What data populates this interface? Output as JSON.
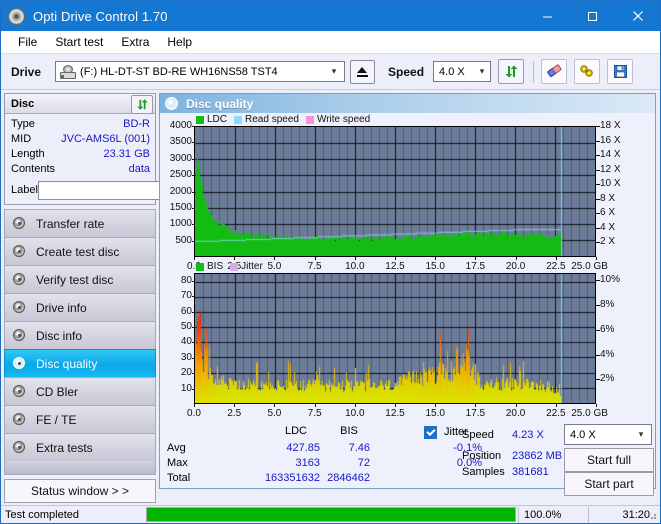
{
  "window": {
    "title": "Opti Drive Control 1.70",
    "icon": "disc-icon",
    "minimize": "minimize-icon",
    "maximize": "maximize-icon",
    "close": "close-icon"
  },
  "menu": {
    "items": [
      "File",
      "Start test",
      "Extra",
      "Help"
    ]
  },
  "toolbar": {
    "drive_label": "Drive",
    "drive_value": "(F:)  HL-DT-ST BD-RE  WH16NS58 TST4",
    "eject": "eject-icon",
    "speed_label": "Speed",
    "speed_value": "4.0 X",
    "refresh": "refresh-icon",
    "erase": "eraser-icon",
    "tools": "tools-icon",
    "save": "save-icon"
  },
  "disc": {
    "header": "Disc",
    "refresh": "refresh-icon",
    "rows": [
      {
        "key": "Type",
        "value": "BD-R"
      },
      {
        "key": "MID",
        "value": "JVC-AMS6L (001)"
      },
      {
        "key": "Length",
        "value": "23.31 GB"
      },
      {
        "key": "Contents",
        "value": "data"
      }
    ],
    "label_key": "Label",
    "label_value": "",
    "label_placeholder": ""
  },
  "sidebar": {
    "items": [
      {
        "label": "Transfer rate",
        "active": false
      },
      {
        "label": "Create test disc",
        "active": false
      },
      {
        "label": "Verify test disc",
        "active": false
      },
      {
        "label": "Drive info",
        "active": false
      },
      {
        "label": "Disc info",
        "active": false
      },
      {
        "label": "Disc quality",
        "active": true
      },
      {
        "label": "CD Bler",
        "active": false
      },
      {
        "label": "FE / TE",
        "active": false
      },
      {
        "label": "Extra tests",
        "active": false
      }
    ],
    "status_button": "Status window > >"
  },
  "panel": {
    "title": "Disc quality",
    "icon": "disc-quality-icon"
  },
  "stats": {
    "col_ldc": "LDC",
    "col_bis": "BIS",
    "jitter_label": "Jitter",
    "jitter_checked": true,
    "rows": [
      {
        "name": "Avg",
        "ldc": "427.85",
        "bis": "7.46",
        "jitter": "-0.1%"
      },
      {
        "name": "Max",
        "ldc": "3163",
        "bis": "72",
        "jitter": "0.0%"
      },
      {
        "name": "Total",
        "ldc": "163351632",
        "bis": "2846462",
        "jitter": ""
      }
    ],
    "speed_label": "Speed",
    "speed_value": "4.23 X",
    "speed_select": "4.0 X",
    "position_label": "Position",
    "position_value": "23862 MB",
    "samples_label": "Samples",
    "samples_value": "381681",
    "start_full": "Start full",
    "start_part": "Start part"
  },
  "statusbar": {
    "text": "Test completed",
    "percent_text": "100.0%",
    "percent": 100,
    "time": "31:20"
  },
  "colors": {
    "accent": "#1477d1",
    "ldc": "#13bc13",
    "read_speed": "#8fd8f7",
    "write_speed": "#ff8fe0",
    "bis_high": "#e00000",
    "bis_low": "#d8e000",
    "plot_bg": "#6d7d99",
    "value_text": "#1818c8",
    "progress": "#00b400"
  },
  "chart_data": [
    {
      "type": "area",
      "name": "ldc-chart",
      "title": "Disc quality",
      "legend": [
        {
          "label": "LDC",
          "color": "#13bc13"
        },
        {
          "label": "Read speed",
          "color": "#8fd8f7"
        },
        {
          "label": "Write speed",
          "color": "#ff8fe0"
        }
      ],
      "legend_position": "top-left",
      "grid": true,
      "xlabel": "GB",
      "xlim": [
        0,
        25.0
      ],
      "xticks": [
        0.0,
        2.5,
        5.0,
        7.5,
        10.0,
        12.5,
        15.0,
        17.5,
        20.0,
        22.5,
        25.0
      ],
      "xticklabels": [
        "0.0",
        "2.5",
        "5.0",
        "7.5",
        "10.0",
        "12.5",
        "15.0",
        "17.5",
        "20.0",
        "22.5",
        "25.0 GB"
      ],
      "ylabel": "LDC",
      "ylim": [
        0,
        4000
      ],
      "yticks": [
        500,
        1000,
        1500,
        2000,
        2500,
        3000,
        3500,
        4000
      ],
      "y2label": "Speed",
      "y2lim": [
        0,
        18
      ],
      "y2ticks": [
        2,
        4,
        6,
        8,
        10,
        12,
        14,
        16,
        18
      ],
      "y2ticklabels": [
        "2 X",
        "4 X",
        "6 X",
        "8 X",
        "10 X",
        "12 X",
        "14 X",
        "16 X",
        "18 X"
      ],
      "data_end_x": 22.9,
      "series": [
        {
          "name": "LDC",
          "color": "#13bc13",
          "x": [
            0.0,
            0.1,
            0.2,
            0.3,
            0.45,
            0.6,
            0.8,
            1.0,
            1.3,
            1.6,
            2.0,
            2.4,
            2.9,
            3.4,
            4.0,
            4.6,
            5.2,
            6.0,
            6.8,
            7.6,
            8.4,
            9.2,
            10.0,
            10.8,
            11.6,
            12.4,
            13.2,
            14.0,
            14.8,
            15.6,
            16.4,
            17.2,
            18.0,
            18.8,
            19.6,
            20.4,
            21.2,
            22.0,
            22.6,
            22.9
          ],
          "values": [
            1500,
            3163,
            2900,
            2400,
            2000,
            1700,
            1450,
            1250,
            1050,
            900,
            800,
            720,
            660,
            620,
            590,
            575,
            560,
            545,
            535,
            530,
            528,
            525,
            525,
            530,
            540,
            555,
            575,
            595,
            615,
            630,
            645,
            655,
            665,
            660,
            650,
            640,
            630,
            620,
            610,
            600
          ]
        },
        {
          "name": "Read speed",
          "color": "#8fd8f7",
          "x": [
            0.0,
            1.0,
            2.0,
            3.0,
            4.0,
            5.0,
            6.0,
            7.0,
            8.0,
            9.0,
            10.0,
            11.0,
            12.0,
            13.0,
            14.0,
            15.0,
            16.0,
            17.0,
            18.0,
            19.0,
            20.0,
            21.0,
            22.0,
            22.9
          ],
          "values": [
            2.1,
            2.15,
            2.22,
            2.3,
            2.38,
            2.46,
            2.55,
            2.63,
            2.72,
            2.8,
            2.88,
            2.96,
            3.04,
            3.12,
            3.2,
            3.3,
            3.38,
            3.46,
            3.54,
            3.62,
            3.7,
            3.74,
            3.78,
            3.8
          ]
        },
        {
          "name": "Write speed",
          "color": "#ff8fe0",
          "x": [],
          "values": []
        }
      ]
    },
    {
      "type": "bar",
      "name": "bis-chart",
      "legend": [
        {
          "label": "BIS",
          "color": "#13bc13"
        },
        {
          "label": "Jitter",
          "color": "#d0b0e0"
        }
      ],
      "legend_position": "top-left",
      "grid": true,
      "xlabel": "GB",
      "xlim": [
        0,
        25.0
      ],
      "xticks": [
        0.0,
        2.5,
        5.0,
        7.5,
        10.0,
        12.5,
        15.0,
        17.5,
        20.0,
        22.5,
        25.0
      ],
      "xticklabels": [
        "0.0",
        "2.5",
        "5.0",
        "7.5",
        "10.0",
        "12.5",
        "15.0",
        "17.5",
        "20.0",
        "22.5",
        "25.0 GB"
      ],
      "ylabel": "BIS",
      "ylim": [
        0,
        85
      ],
      "yticks": [
        10,
        20,
        30,
        40,
        50,
        60,
        70,
        80
      ],
      "y2label": "Jitter",
      "y2lim": [
        0,
        10.6
      ],
      "y2ticks": [
        2,
        4,
        6,
        8,
        10
      ],
      "y2ticklabels": [
        "2%",
        "4%",
        "6%",
        "8%",
        "10%"
      ],
      "data_end_x": 22.9,
      "series": [
        {
          "name": "BIS",
          "color_scale": [
            "#d8e000",
            "#ff9000",
            "#e00000"
          ],
          "x": [
            0.05,
            0.15,
            0.3,
            0.5,
            0.8,
            1.2,
            1.8,
            2.5,
            3.2,
            4.0,
            5.0,
            6.0,
            7.0,
            8.0,
            9.0,
            10.0,
            11.0,
            12.0,
            12.8,
            13.5,
            14.2,
            15.0,
            15.8,
            16.5,
            17.0,
            17.4,
            18.0,
            19.0,
            20.0,
            21.0,
            22.0,
            22.6,
            22.9
          ],
          "values": [
            72,
            64,
            52,
            36,
            26,
            20,
            16,
            14,
            13,
            13,
            13,
            13,
            13,
            13,
            13,
            13,
            13,
            13,
            15,
            18,
            20,
            22,
            24,
            26,
            30,
            24,
            14,
            14,
            14,
            14,
            13,
            10,
            6
          ]
        }
      ]
    }
  ]
}
